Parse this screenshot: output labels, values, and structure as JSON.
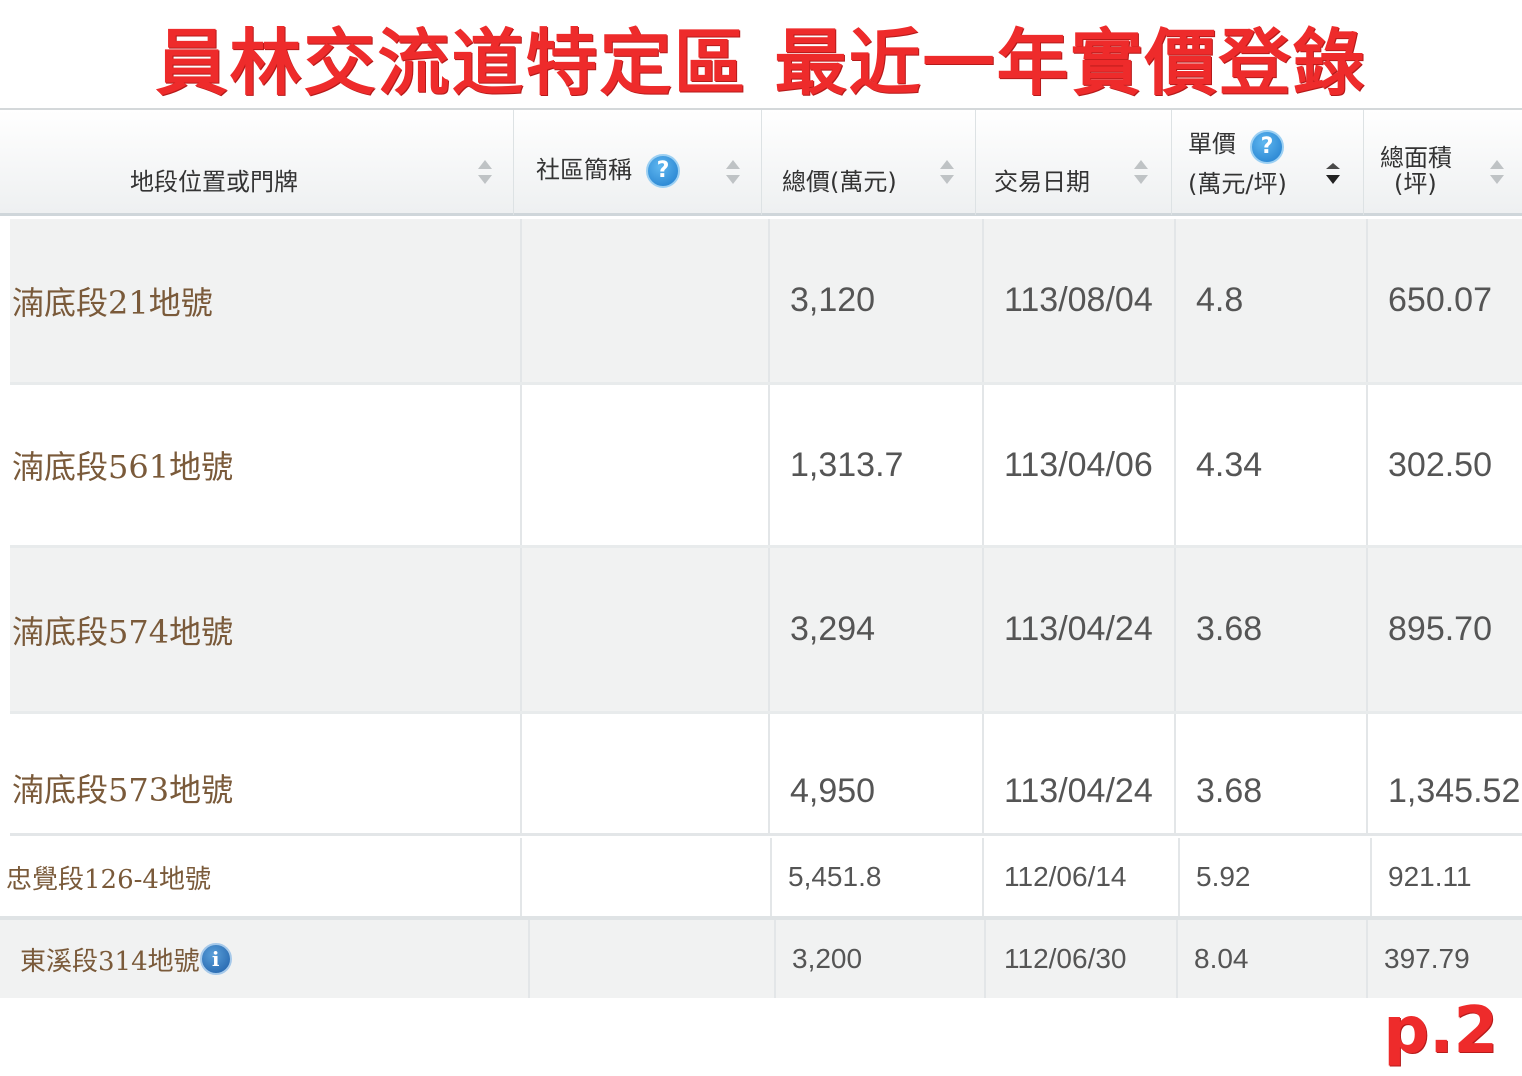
{
  "title": "員林交流道特定區 最近一年實價登錄",
  "page_label": "p.2",
  "table": {
    "headers": {
      "address": "地段位置或門牌",
      "community": "社區簡稱",
      "total_price": "總價(萬元)",
      "date": "交易日期",
      "unit_price_line1": "單價",
      "unit_price_line2": "(萬元/坪)",
      "area_line1": "總面積",
      "area_line2": "(坪)"
    },
    "rows": [
      {
        "address": "湳底段21地號",
        "community": "",
        "total_price": "3,120",
        "date": "113/08/04",
        "unit_price": "4.8",
        "area": "650.07"
      },
      {
        "address": "湳底段561地號",
        "community": "",
        "total_price": "1,313.7",
        "date": "113/04/06",
        "unit_price": "4.34",
        "area": "302.50"
      },
      {
        "address": "湳底段574地號",
        "community": "",
        "total_price": "3,294",
        "date": "113/04/24",
        "unit_price": "3.68",
        "area": "895.70"
      },
      {
        "address": "湳底段573地號",
        "community": "",
        "total_price": "4,950",
        "date": "113/04/24",
        "unit_price": "3.68",
        "area": "1,345.52"
      },
      {
        "address": "忠覺段126-4地號",
        "community": "",
        "total_price": "5,451.8",
        "date": "112/06/14",
        "unit_price": "5.92",
        "area": "921.11"
      },
      {
        "address": "東溪段314地號",
        "community": "",
        "total_price": "3,200",
        "date": "112/06/30",
        "unit_price": "8.04",
        "area": "397.79"
      }
    ]
  },
  "icons": {
    "help": "question-mark-help-icon",
    "info": "info-icon",
    "sort": "sort-arrows-icon"
  },
  "colors": {
    "title": "#ee2b2b",
    "address_text": "#7a5a3a",
    "help_icon": "#1f7ccc"
  }
}
